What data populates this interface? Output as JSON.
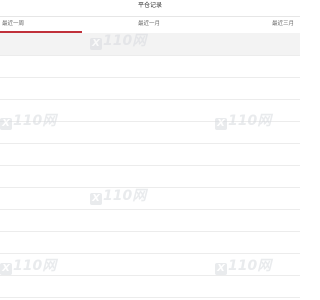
{
  "header": {
    "title": "平仓记录"
  },
  "tabs": [
    {
      "label": "最近一周",
      "active": true
    },
    {
      "label": "最近一月",
      "active": false
    },
    {
      "label": "最近三月",
      "active": false
    }
  ],
  "colors": {
    "accent": "#c0303a",
    "divider": "#ececec",
    "row_shade": "#f3f3f3"
  },
  "watermark": {
    "text": "110网",
    "badge": "X"
  }
}
